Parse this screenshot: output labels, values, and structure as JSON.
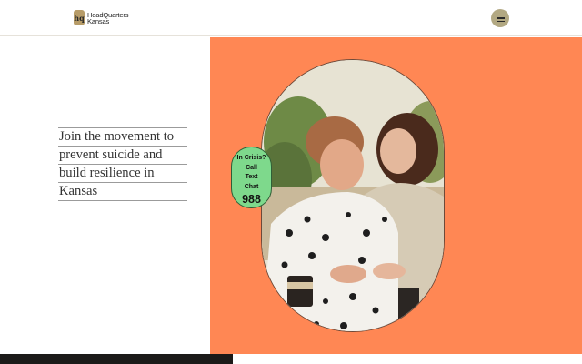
{
  "header": {
    "logo_mark": "hq",
    "logo_line1": "HeadQuarters",
    "logo_line2": "Kansas",
    "menu_icon": "hamburger-icon"
  },
  "hero": {
    "headline_lines": [
      "Join the movement to",
      "prevent suicide and",
      "build resilience in",
      "Kansas"
    ],
    "photo_icon": "photo-two-women-embracing"
  },
  "crisis": {
    "line1": "In Crisis?",
    "line2": "Call",
    "line3": "Text",
    "line4": "Chat",
    "number": "988"
  },
  "colors": {
    "accent_orange": "#ff8754",
    "crisis_green": "#7ed98c",
    "menu_khaki": "#b2a882"
  }
}
